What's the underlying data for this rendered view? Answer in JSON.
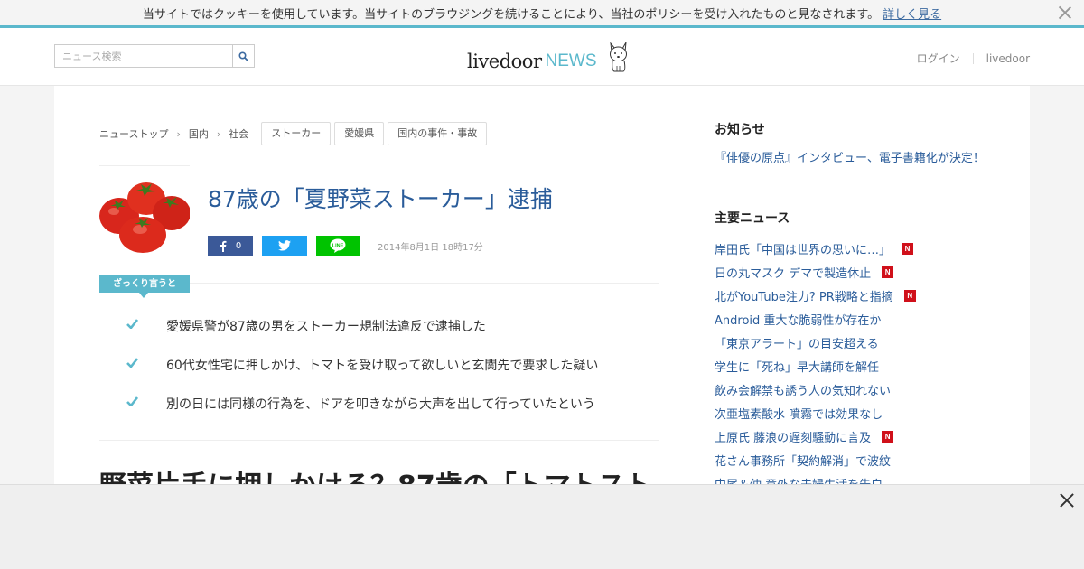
{
  "cookie_bar": {
    "text": "当サイトではクッキーを使用しています。当サイトのブラウジングを続けることにより、当社のポリシーを受け入れたものと見なされます。",
    "link": "詳しく見る"
  },
  "header": {
    "search_placeholder": "ニュース検索",
    "logo_main": "livedoor",
    "logo_news": "NEWS",
    "login": "ログイン",
    "livedoor_link": "livedoor"
  },
  "breadcrumb": [
    "ニューストップ",
    "国内",
    "社会"
  ],
  "tags": [
    "ストーカー",
    "愛媛県",
    "国内の事件・事故"
  ],
  "article": {
    "title": "87歳の「夏野菜ストーカー」逮捕",
    "fb_count": "0",
    "date": "2014年8月1日 18時17分",
    "summary_label": "ざっくり言うと",
    "points": [
      "愛媛県警が87歳の男をストーカー規制法違反で逮捕した",
      "60代女性宅に押しかけ、トマトを受け取って欲しいと玄関先で要求した疑い",
      "別の日には同様の行為を、ドアを叩きながら大声を出して行っていたという"
    ],
    "headline": "野菜片手に押しかける？87歳の「トマトスト"
  },
  "sidebar": {
    "notice_heading": "お知らせ",
    "notice_text": "『俳優の原点』インタビュー、電子書籍化が決定！",
    "major_heading": "主要ニュース",
    "news": [
      {
        "text": "岸田氏「中国は世界の思いに…」",
        "badge": "N"
      },
      {
        "text": "日の丸マスク デマで製造休止",
        "badge": "N"
      },
      {
        "text": "北がYouTube注力? PR戦略と指摘",
        "badge": "N"
      },
      {
        "text": "Android 重大な脆弱性が存在か",
        "badge": ""
      },
      {
        "text": "「東京アラート」の目安超える",
        "badge": ""
      },
      {
        "text": "学生に「死ね」早大講師を解任",
        "badge": ""
      },
      {
        "text": "飲み会解禁も誘う人の気知れない",
        "badge": ""
      },
      {
        "text": "次亜塩素酸水 噴霧では効果なし",
        "badge": ""
      },
      {
        "text": "上原氏 藤浪の遅刻騒動に言及",
        "badge": "N"
      },
      {
        "text": "花さん事務所「契約解消」で波紋",
        "badge": ""
      },
      {
        "text": "中尾＆仲 意外な夫婦生活を告白",
        "badge": ""
      }
    ]
  },
  "colors": {
    "accent": "#5bb8cc",
    "link": "#2a5c9a",
    "facebook": "#3b5998",
    "twitter": "#1da1f2",
    "line": "#00c300",
    "badge": "#d0101a"
  }
}
